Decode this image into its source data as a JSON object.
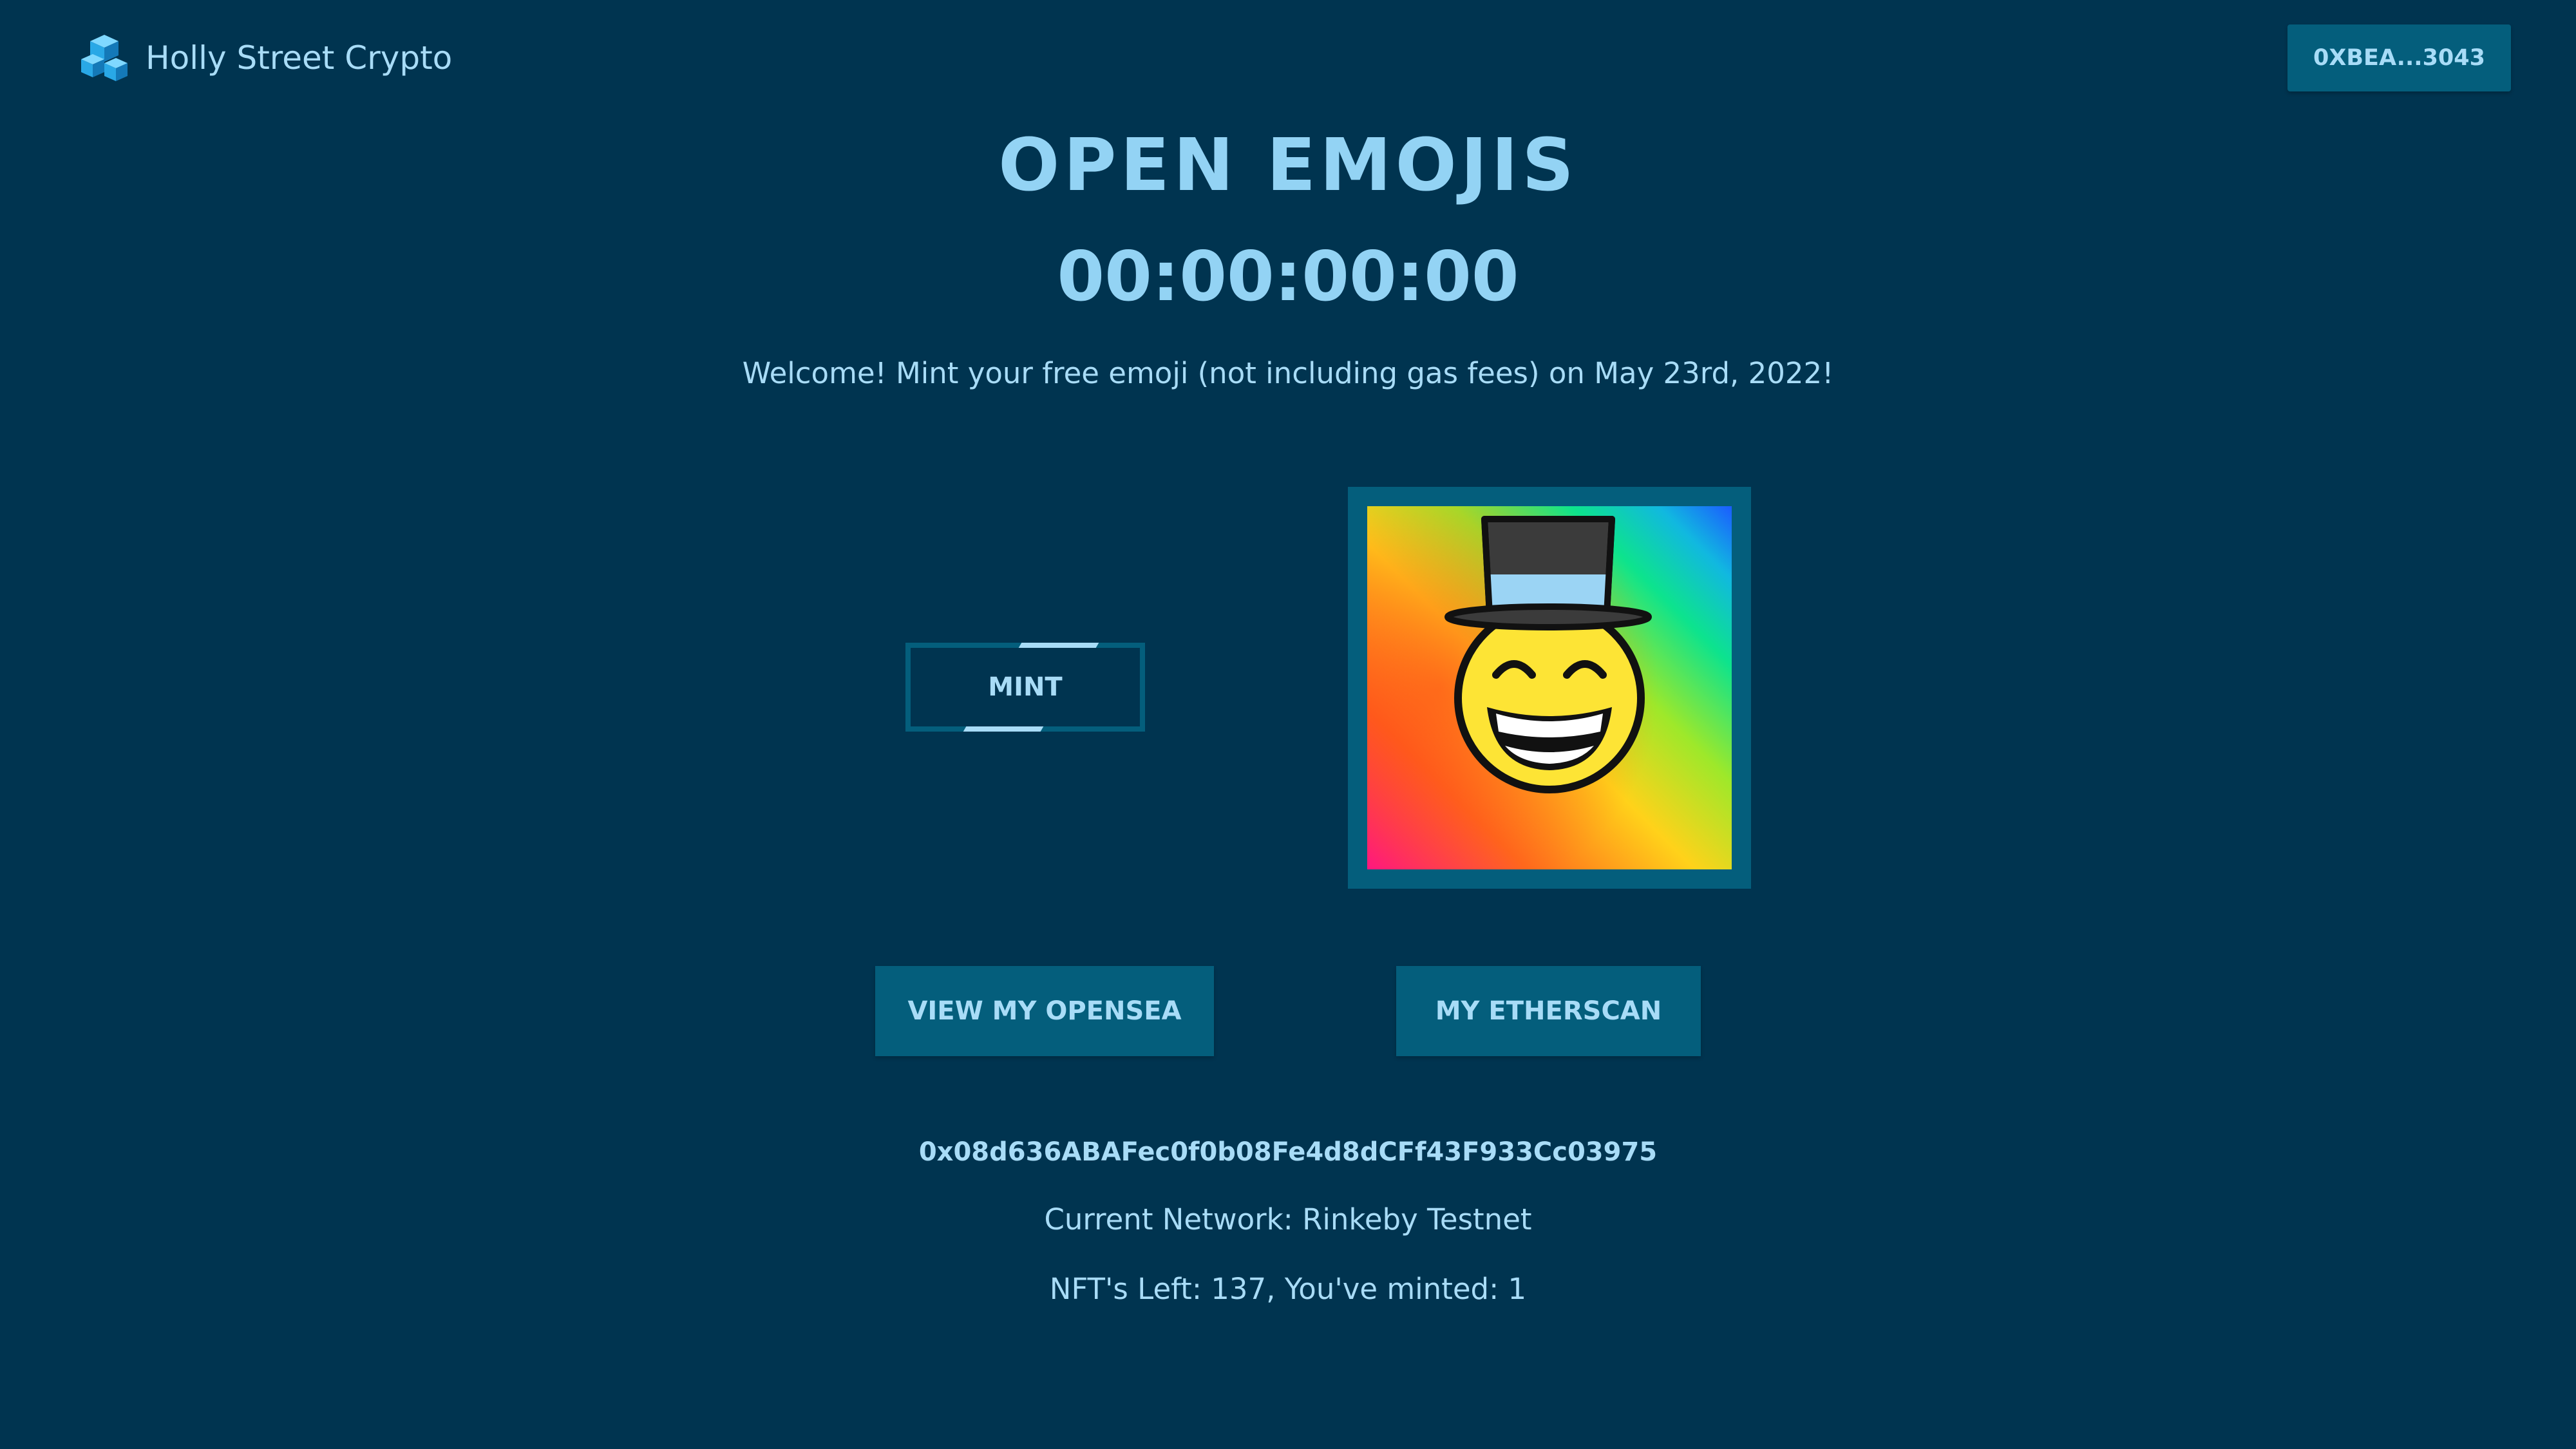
{
  "header": {
    "brand_name": "Holly Street Crypto",
    "logo_icon": "cubes-logo-icon",
    "wallet_label": "0XBEA...3043"
  },
  "main": {
    "title": "OPEN EMOJIS",
    "countdown": "00:00:00:00",
    "welcome": "Welcome! Mint your free emoji (not including gas fees) on May 23rd, 2022!",
    "mint_label": "MINT",
    "nft_image": "top-hat-grinning-emoji-on-rainbow-gradient",
    "opensea_label": "VIEW MY OPENSEA",
    "etherscan_label": "MY ETHERSCAN"
  },
  "footer": {
    "contract_address": "0x08d636ABAFec0f0b08Fe4d8dCFf43F933Cc03975",
    "network": "Current Network: Rinkeby Testnet",
    "supply": "NFT's Left: 137, You've minted: 1"
  },
  "colors": {
    "background": "#003450",
    "accent": "#045e7c",
    "text": "#a8dcf7"
  }
}
